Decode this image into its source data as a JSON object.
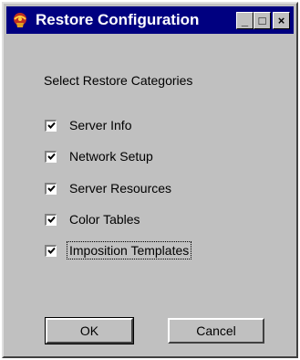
{
  "window": {
    "title": "Restore Configuration",
    "minimize_glyph": "_",
    "maximize_glyph": "□",
    "close_glyph": "×",
    "icon": "app-icon",
    "title_color": "#000080"
  },
  "dialog": {
    "section_label": "Select Restore Categories",
    "options": [
      {
        "label": "Server Info",
        "checked": true
      },
      {
        "label": "Network Setup",
        "checked": true
      },
      {
        "label": "Server Resources",
        "checked": true
      },
      {
        "label": "Color Tables",
        "checked": true
      },
      {
        "label": "Imposition Templates",
        "checked": true,
        "focused": true
      }
    ],
    "ok_label": "OK",
    "cancel_label": "Cancel"
  }
}
